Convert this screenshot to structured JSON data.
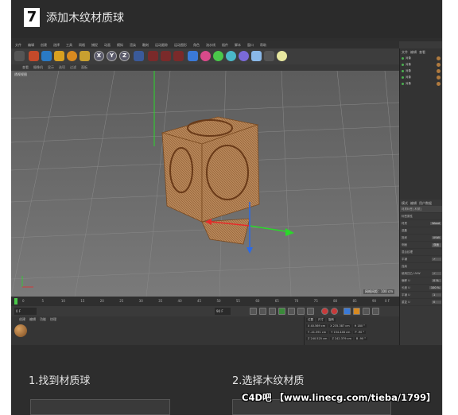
{
  "header": {
    "step_number": "7",
    "title": "添加木纹材质球"
  },
  "app": {
    "menubar": [
      "文件",
      "编辑",
      "创建",
      "选择",
      "工具",
      "网格",
      "捕捉",
      "动画",
      "模拟",
      "渲染",
      "雕刻",
      "运动跟踪",
      "运动图形",
      "角色",
      "流水线",
      "插件",
      "脚本",
      "窗口",
      "帮助"
    ],
    "toolbar_axes": [
      "X",
      "Y",
      "Z"
    ],
    "view_menu": [
      "查看",
      "摄像机",
      "显示",
      "选项",
      "过滤",
      "面板"
    ],
    "viewport_label": "透视视图",
    "grid_distance": "网格间距：100 cm",
    "object_manager_tabs": [
      "文件",
      "编辑",
      "查看"
    ],
    "objects": [
      "对象",
      "对象",
      "对象",
      "对象",
      "对象"
    ],
    "attribute_tabs": [
      "模式",
      "编辑",
      "用户数据"
    ],
    "attribute_title": "材质标签 [材质]",
    "attribute_rows": [
      {
        "key": "标签属性",
        "value": ""
      },
      {
        "key": "材质",
        "value": "Wood"
      },
      {
        "key": "选集",
        "value": ""
      },
      {
        "key": "投射",
        "value": "UVW"
      },
      {
        "key": "侧面",
        "value": "双面"
      },
      {
        "key": "混合纹理",
        "value": ""
      },
      {
        "key": "平铺",
        "value": "✓"
      },
      {
        "key": "连续",
        "value": ""
      },
      {
        "key": "使用凹凸 UVW",
        "value": "✓"
      },
      {
        "key": "偏移 U",
        "value": "0 %"
      },
      {
        "key": "长度 U",
        "value": "100 %"
      },
      {
        "key": "平铺 U",
        "value": "1"
      },
      {
        "key": "重复 U",
        "value": "0"
      }
    ],
    "timeline_ticks": [
      "0",
      "5",
      "10",
      "15",
      "20",
      "25",
      "30",
      "35",
      "40",
      "45",
      "50",
      "55",
      "60",
      "65",
      "70",
      "75",
      "80",
      "85",
      "90"
    ],
    "timeline_end": "0 F",
    "transport_start": "0 F",
    "transport_fields": [
      "0 F",
      "90 F",
      "90 F"
    ],
    "material_tabs": [
      "创建",
      "编辑",
      "功能",
      "纹理"
    ],
    "coords_headers": [
      "位置",
      "尺寸",
      "旋转"
    ],
    "coords": [
      [
        "X 40.569 cm",
        "X 235.387 cm",
        "H 180 °"
      ],
      [
        "Y -41.591 cm",
        "Y 154.446 cm",
        "P -90 °"
      ],
      [
        "Z 240.525 cm",
        "Z 242.379 cm",
        "B -90 °"
      ]
    ]
  },
  "bottom": {
    "caption1": "1.找到材质球",
    "caption2": "2.选择木纹材质",
    "watermark": "C4D吧 【www.linecg.com/tieba/1799】"
  }
}
